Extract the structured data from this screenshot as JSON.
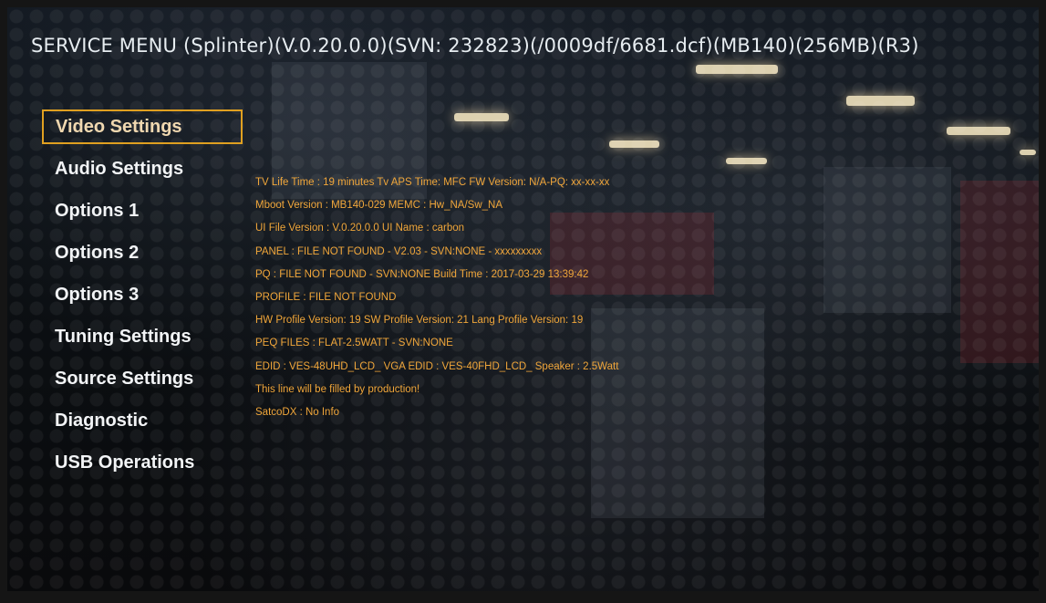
{
  "header": {
    "title": "SERVICE MENU (Splinter)(V.0.20.0.0)(SVN: 232823)(/0009df/6681.dcf)(MB140)(256MB)(R3)"
  },
  "menu": {
    "items": [
      {
        "label": "Video Settings",
        "selected": true
      },
      {
        "label": "Audio Settings"
      },
      {
        "label": "Options 1"
      },
      {
        "label": "Options 2"
      },
      {
        "label": "Options 3"
      },
      {
        "label": "Tuning Settings"
      },
      {
        "label": "Source Settings"
      },
      {
        "label": "Diagnostic"
      },
      {
        "label": "USB Operations"
      }
    ]
  },
  "info": {
    "lines": [
      "TV Life Time : 19 minutes  Tv APS Time:  MFC FW Version: N/A-PQ: xx-xx-xx",
      "Mboot Version : MB140-029  MEMC : Hw_NA/Sw_NA",
      "UI File Version : V.0.20.0.0  UI Name : carbon",
      "PANEL : FILE NOT FOUND - V2.03 - SVN:NONE - xxxxxxxxx",
      "PQ : FILE NOT FOUND - SVN:NONE Build Time : 2017-03-29 13:39:42",
      "PROFILE : FILE NOT FOUND",
      "HW Profile Version: 19  SW Profile Version: 21  Lang Profile Version: 19",
      "PEQ FILES : FLAT-2.5WATT - SVN:NONE",
      "EDID : VES-48UHD_LCD_    VGA EDID : VES-40FHD_LCD_    Speaker : 2.5Watt",
      "This line will be filled by production!",
      "SatcoDX : No Info"
    ]
  },
  "colors": {
    "accent": "#e0a020",
    "info_text": "#f0a63a",
    "menu_text": "#f2f4f6"
  }
}
